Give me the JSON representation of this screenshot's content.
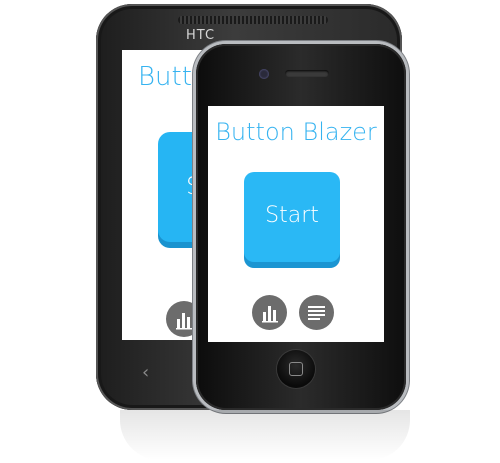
{
  "htc": {
    "brand": "HTC",
    "app_title": "Button Blazer",
    "start_label": "Start",
    "nav_back": "‹"
  },
  "iphone": {
    "app_title": "Button Blazer",
    "start_label": "Start"
  },
  "icons": {
    "stats": "bar-chart-icon",
    "menu": "menu-lines-icon"
  },
  "colors": {
    "accent": "#36b3f0",
    "button": "#2ab8f5",
    "button_shadow": "#1b95d2",
    "icon_circle": "#6c6c6c"
  }
}
